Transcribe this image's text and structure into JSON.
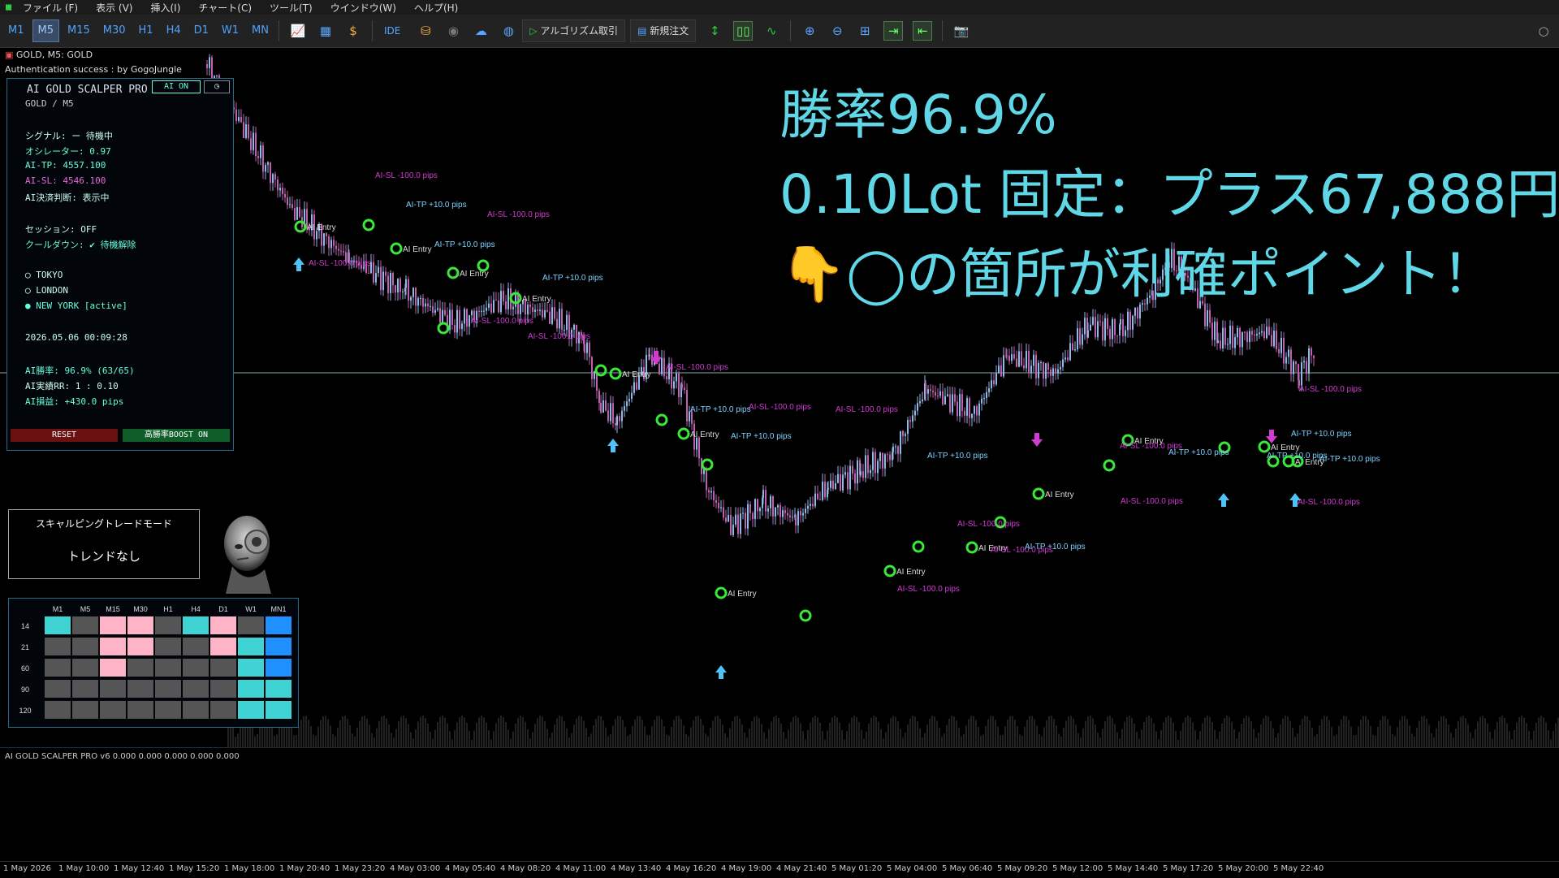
{
  "menu": [
    "ファイル (F)",
    "表示 (V)",
    "挿入(I)",
    "チャート(C)",
    "ツール(T)",
    "ウインドウ(W)",
    "ヘルプ(H)"
  ],
  "timeframes": [
    "M1",
    "M5",
    "M15",
    "M30",
    "H1",
    "H4",
    "D1",
    "W1",
    "MN"
  ],
  "active_timeframe": "M5",
  "toolbar": {
    "ide_label": "IDE",
    "algo_label": "アルゴリズム取引",
    "new_order_label": "新規注文"
  },
  "chart": {
    "symbol_line": "GOLD, M5: GOLD",
    "auth_line": "Authentication success : by GogoJungle"
  },
  "panel": {
    "title": "AI GOLD SCALPER PRO",
    "ai_on": "AI ON",
    "clock_icon": "clock-icon",
    "symbol": "GOLD / M5",
    "signal": "シグナル: ー 待機中",
    "oscillator": "オシレーター: 0.97",
    "ai_tp": "AI-TP: 4557.100",
    "ai_sl": "AI-SL: 4546.100",
    "ai_decision": "AI決済判断: 表示中",
    "session": "セッション: OFF",
    "cooldown": "クールダウン: ✔ 待機解除",
    "tokyo": "◯ TOKYO",
    "london": "◯ LONDON",
    "newyork": "● NEW YORK [active]",
    "datetime": "2026.05.06 00:09:28",
    "winrate": "AI勝率: 96.9% (63/65)",
    "rr": "AI実績RR: 1 : 0.10",
    "profit": "AI損益: +430.0 pips",
    "reset": "RESET",
    "boost": "高勝率BOOST ON"
  },
  "headline": {
    "line1": "勝率96.9%",
    "line2": "0.10Lot 固定：プラス67,888円",
    "line3": "👇◯の箇所が利確ポイント！"
  },
  "mode_box": {
    "title": "スキャルピングトレードモード",
    "value": "トレンドなし"
  },
  "matrix": {
    "columns": [
      "M1",
      "M5",
      "M15",
      "M30",
      "H1",
      "H4",
      "D1",
      "W1",
      "MN1"
    ],
    "rows": [
      "14",
      "21",
      "60",
      "90",
      "120"
    ],
    "cells": [
      [
        "cyan",
        "gray",
        "pink",
        "pink",
        "gray",
        "cyan",
        "pink",
        "gray",
        "blue"
      ],
      [
        "gray",
        "gray",
        "pink",
        "pink",
        "gray",
        "gray",
        "pink",
        "cyan",
        "blue"
      ],
      [
        "gray",
        "gray",
        "pink",
        "gray",
        "gray",
        "gray",
        "gray",
        "cyan",
        "blue"
      ],
      [
        "gray",
        "gray",
        "gray",
        "gray",
        "gray",
        "gray",
        "gray",
        "cyan",
        "cyan"
      ],
      [
        "gray",
        "gray",
        "gray",
        "gray",
        "gray",
        "gray",
        "gray",
        "cyan",
        "cyan"
      ]
    ],
    "colors": {
      "cyan": "#3fd3d3",
      "pink": "#ffb3c6",
      "gray": "#555555",
      "blue": "#1e90ff"
    }
  },
  "signal_labels": {
    "entry": "AI Entry",
    "tp": "AI-TP +10.0 pips",
    "sl": "AI-SL -100.0 pips"
  },
  "indicator": {
    "label": "AI GOLD SCALPER PRO v6 0.000 0.000 0.000 0.000 0.000"
  },
  "time_axis": [
    "1 May 2026",
    "1 May 10:00",
    "1 May 12:40",
    "1 May 15:20",
    "1 May 18:00",
    "1 May 20:40",
    "1 May 23:20",
    "4 May 03:00",
    "4 May 05:40",
    "4 May 08:20",
    "4 May 11:00",
    "4 May 13:40",
    "4 May 16:20",
    "4 May 19:00",
    "4 May 21:40",
    "5 May 01:20",
    "5 May 04:00",
    "5 May 06:40",
    "5 May 09:20",
    "5 May 12:00",
    "5 May 14:40",
    "5 May 17:20",
    "5 May 20:00",
    "5 May 22:40"
  ],
  "colors": {
    "accent": "#5fd7e6",
    "entry": "#39e639",
    "sl": "#d13bd1",
    "tp": "#7fd1ff"
  }
}
